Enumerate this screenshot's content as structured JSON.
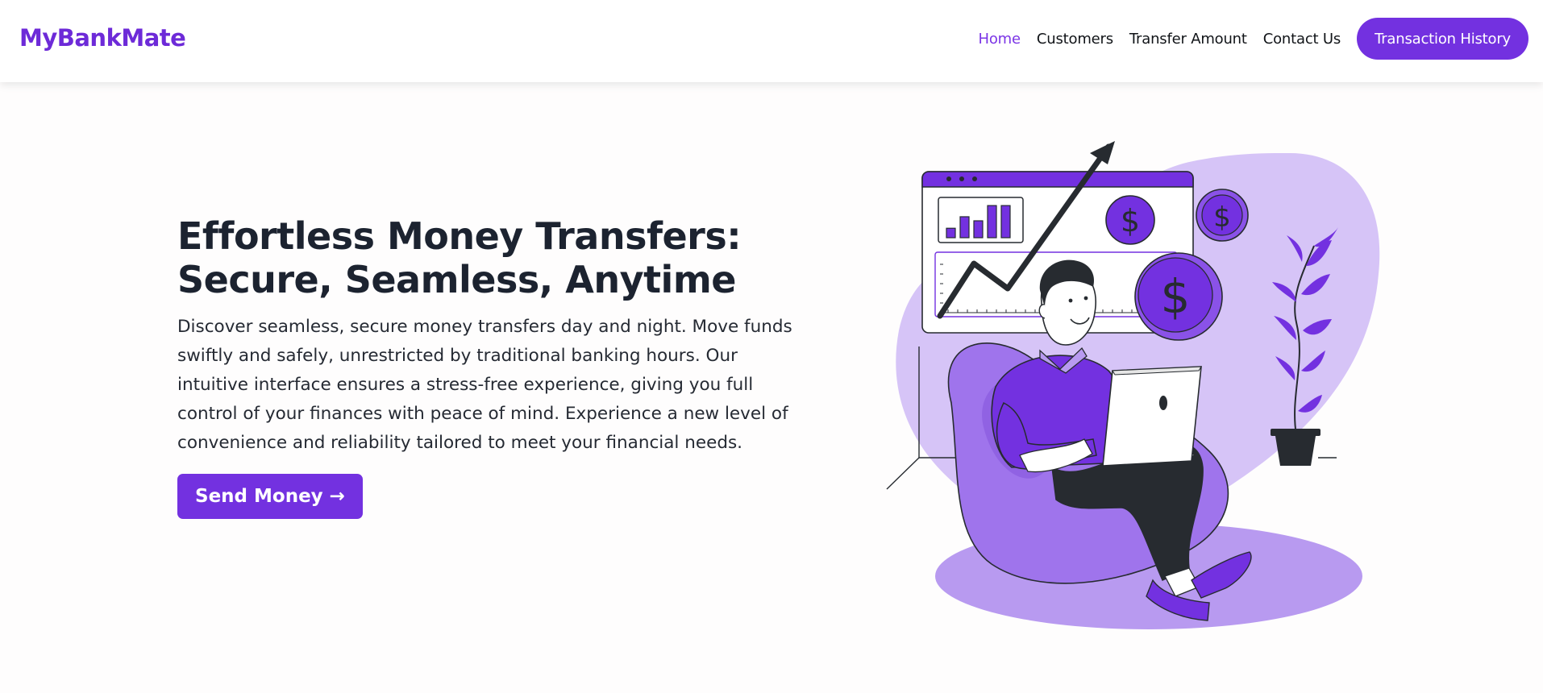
{
  "brand": {
    "name": "MyBankMate"
  },
  "nav": {
    "items": [
      {
        "label": "Home",
        "active": true
      },
      {
        "label": "Customers",
        "active": false
      },
      {
        "label": "Transfer Amount",
        "active": false
      },
      {
        "label": "Contact Us",
        "active": false
      }
    ],
    "cta_label": "Transaction History"
  },
  "hero": {
    "title": "Effortless Money Transfers: Secure, Seamless, Anytime",
    "description": "Discover seamless, secure money transfers day and night. Move funds swiftly and safely, unrestricted by traditional banking hours. Our intuitive interface ensures a stress-free experience, giving you full control of your finances with peace of mind. Experience a new level of convenience and reliability tailored to meet your financial needs.",
    "button_label": "Send Money",
    "button_arrow": "→"
  },
  "illustration": {
    "coin_symbol": "$",
    "bar_levels": [
      0.28,
      0.62,
      0.5,
      0.95,
      0.95
    ],
    "colors": {
      "accent": "#7331e0",
      "light_purple": "#d6c4f7",
      "mid_purple": "#b89af0",
      "dark": "#272b30"
    }
  }
}
